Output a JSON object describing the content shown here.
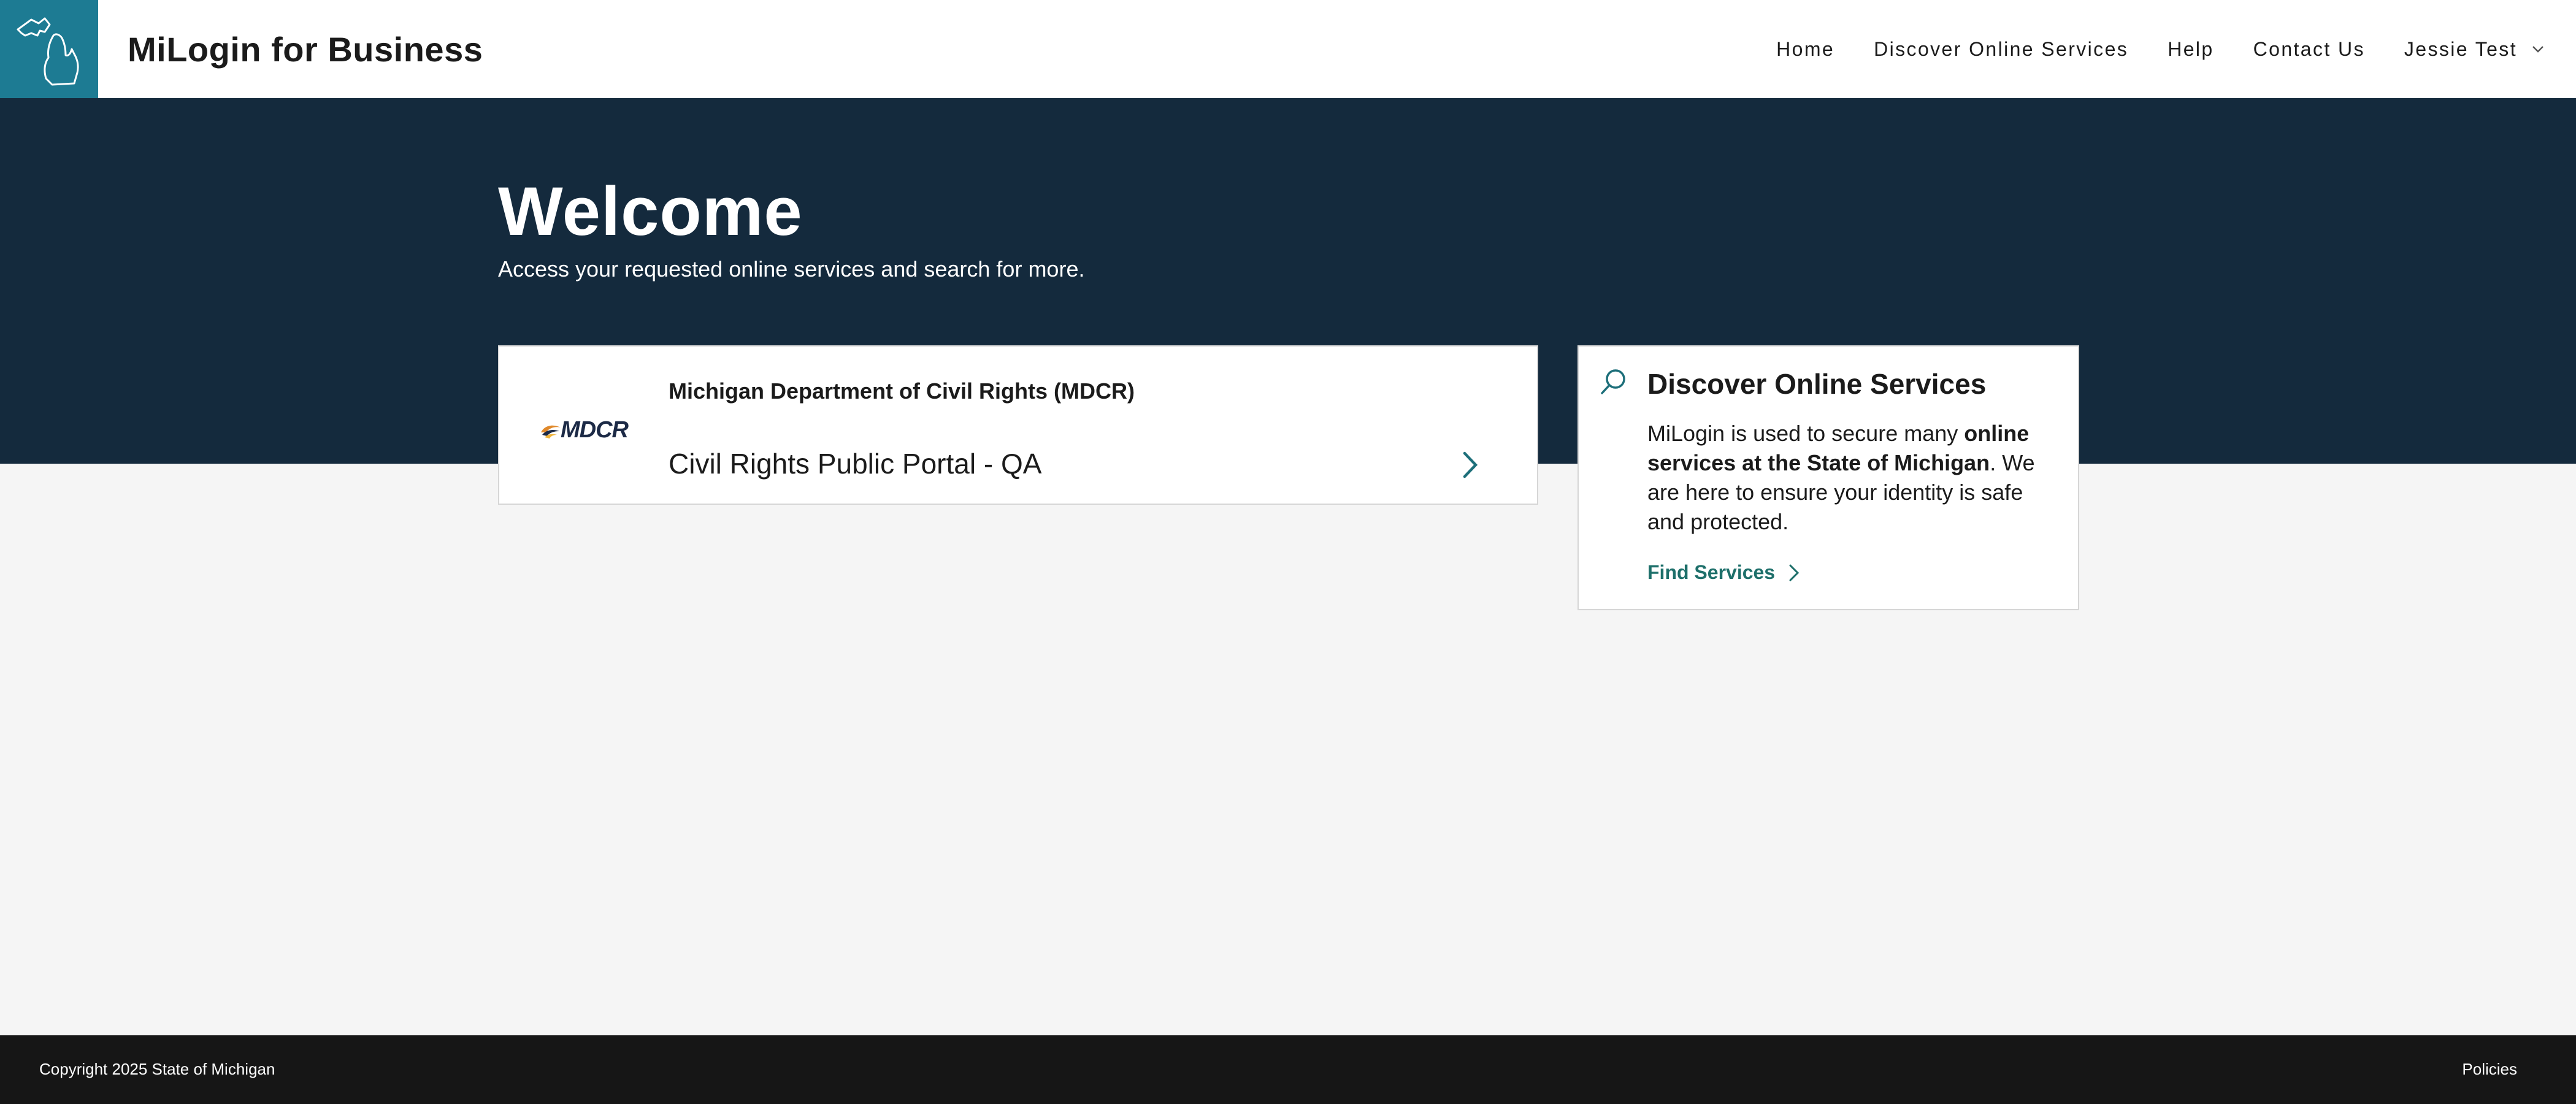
{
  "header": {
    "logo_icon": "michigan-state-outline-icon",
    "app_title": "MiLogin for Business",
    "nav": {
      "home": "Home",
      "discover": "Discover Online Services",
      "help": "Help",
      "contact": "Contact Us",
      "user": "Jessie Test"
    }
  },
  "hero": {
    "title": "Welcome",
    "subtitle": "Access your requested online services and search for more."
  },
  "service_card": {
    "logo_text": "MDCR",
    "department": "Michigan Department of Civil Rights (MDCR)",
    "service": "Civil Rights Public Portal - QA"
  },
  "discover": {
    "title": "Discover Online Services",
    "body_pre": "MiLogin is used to secure many ",
    "body_bold": "online services at the State of Michigan",
    "body_post": ". We are here to ensure your identity is safe and protected.",
    "link": "Find Services"
  },
  "footer": {
    "copyright": "Copyright 2025 State of Michigan",
    "policies": "Policies"
  },
  "colors": {
    "brand_teal": "#1d7b93",
    "hero_navy": "#142a3d",
    "link_green": "#1d6f6a",
    "footer_black": "#161616"
  }
}
